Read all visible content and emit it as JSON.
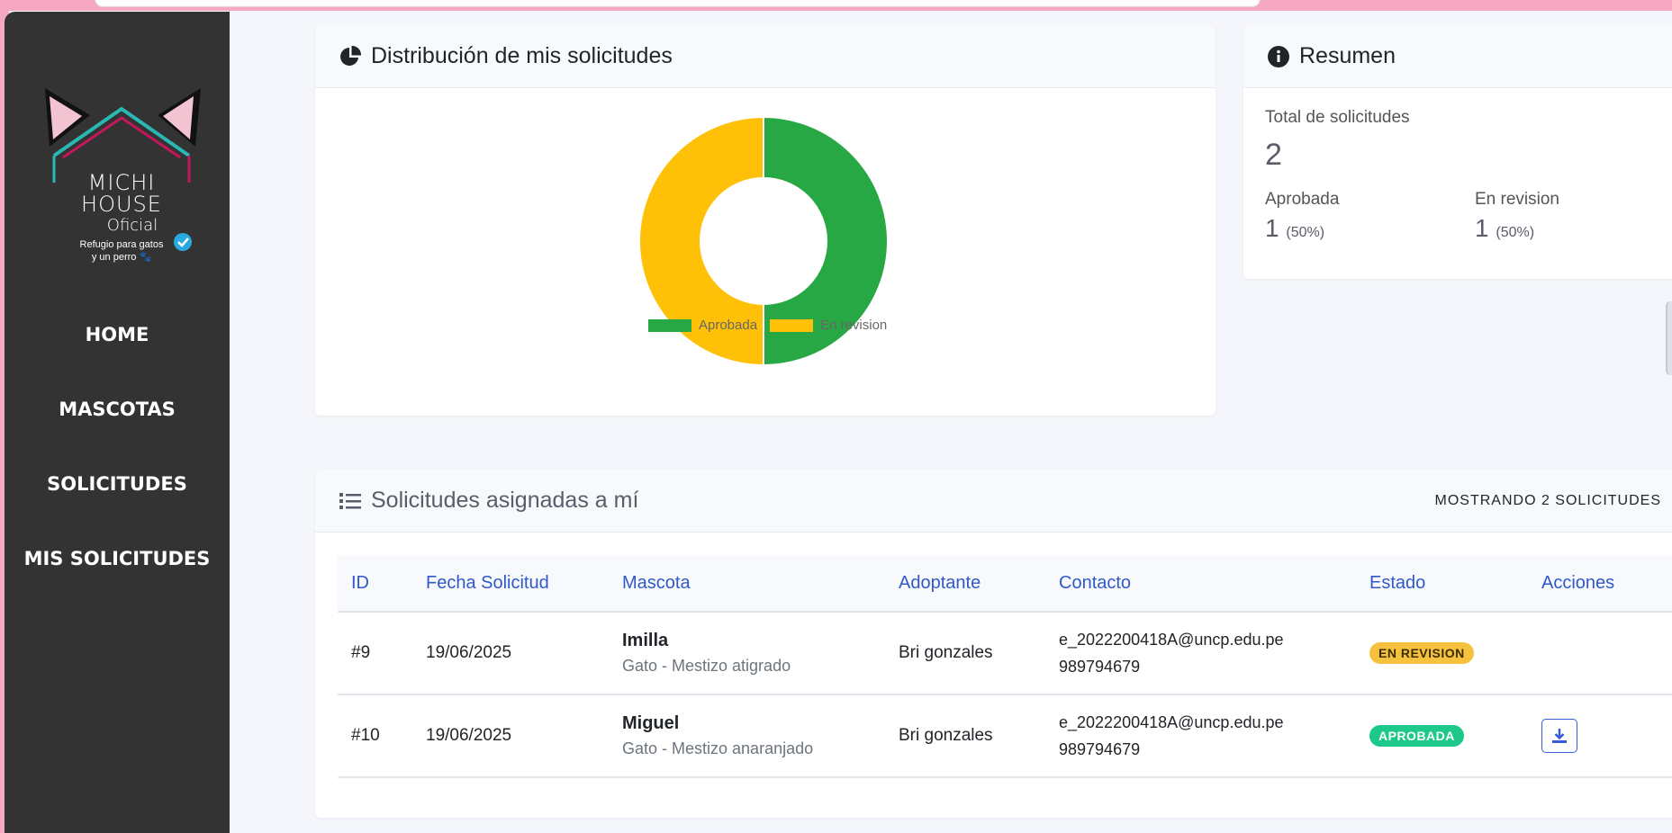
{
  "sidebar": {
    "logo": {
      "line1": "MICHI",
      "line2": "HOUSE",
      "line3": "Oficial",
      "tagline_line1": "Refugio para gatos",
      "tagline_line2": "y un perro 🐾"
    },
    "items": [
      {
        "label": "HOME"
      },
      {
        "label": "MASCOTAS"
      },
      {
        "label": "SOLICITUDES"
      },
      {
        "label": "MIS SOLICITUDES"
      }
    ]
  },
  "distribution": {
    "title": "Distribución de mis solicitudes",
    "icon": "pie-chart-icon"
  },
  "chart_data": {
    "type": "pie",
    "categories": [
      "Aprobada",
      "En revision"
    ],
    "values": [
      1,
      1
    ],
    "colors": [
      "#28a745",
      "#ffc107"
    ],
    "legend_position": "bottom"
  },
  "summary": {
    "title": "Resumen",
    "icon": "info-circle-icon",
    "total_label": "Total de solicitudes",
    "total_value": "2",
    "approved_label": "Aprobada",
    "approved_value": "1",
    "approved_pct": "(50%)",
    "review_label": "En revision",
    "review_value": "1",
    "review_pct": "(50%)"
  },
  "assigned": {
    "title": "Solicitudes asignadas a mí",
    "icon": "list-icon",
    "showing": "MOSTRANDO 2 SOLICITUDES",
    "columns": [
      "ID",
      "Fecha Solicitud",
      "Mascota",
      "Adoptante",
      "Contacto",
      "Estado",
      "Acciones"
    ],
    "rows": [
      {
        "id": "#9",
        "date": "19/06/2025",
        "pet_name": "Imilla",
        "pet_detail": "Gato - Mestizo atigrado",
        "adopter": "Bri gonzales",
        "email": "e_2022200418A@uncp.edu.pe",
        "phone": "989794679",
        "status": "EN REVISION"
      },
      {
        "id": "#10",
        "date": "19/06/2025",
        "pet_name": "Miguel",
        "pet_detail": "Gato - Mestizo anaranjado",
        "adopter": "Bri gonzales",
        "email": "e_2022200418A@uncp.edu.pe",
        "phone": "989794679",
        "status": "APROBADA"
      }
    ]
  },
  "colors": {
    "sidebar_bg": "#333333",
    "accent_blue": "#2f59c8",
    "approved": "#28a745",
    "review": "#ffc107",
    "page_bg": "#f4f6fb",
    "frame_pink": "#f6a7c1"
  }
}
